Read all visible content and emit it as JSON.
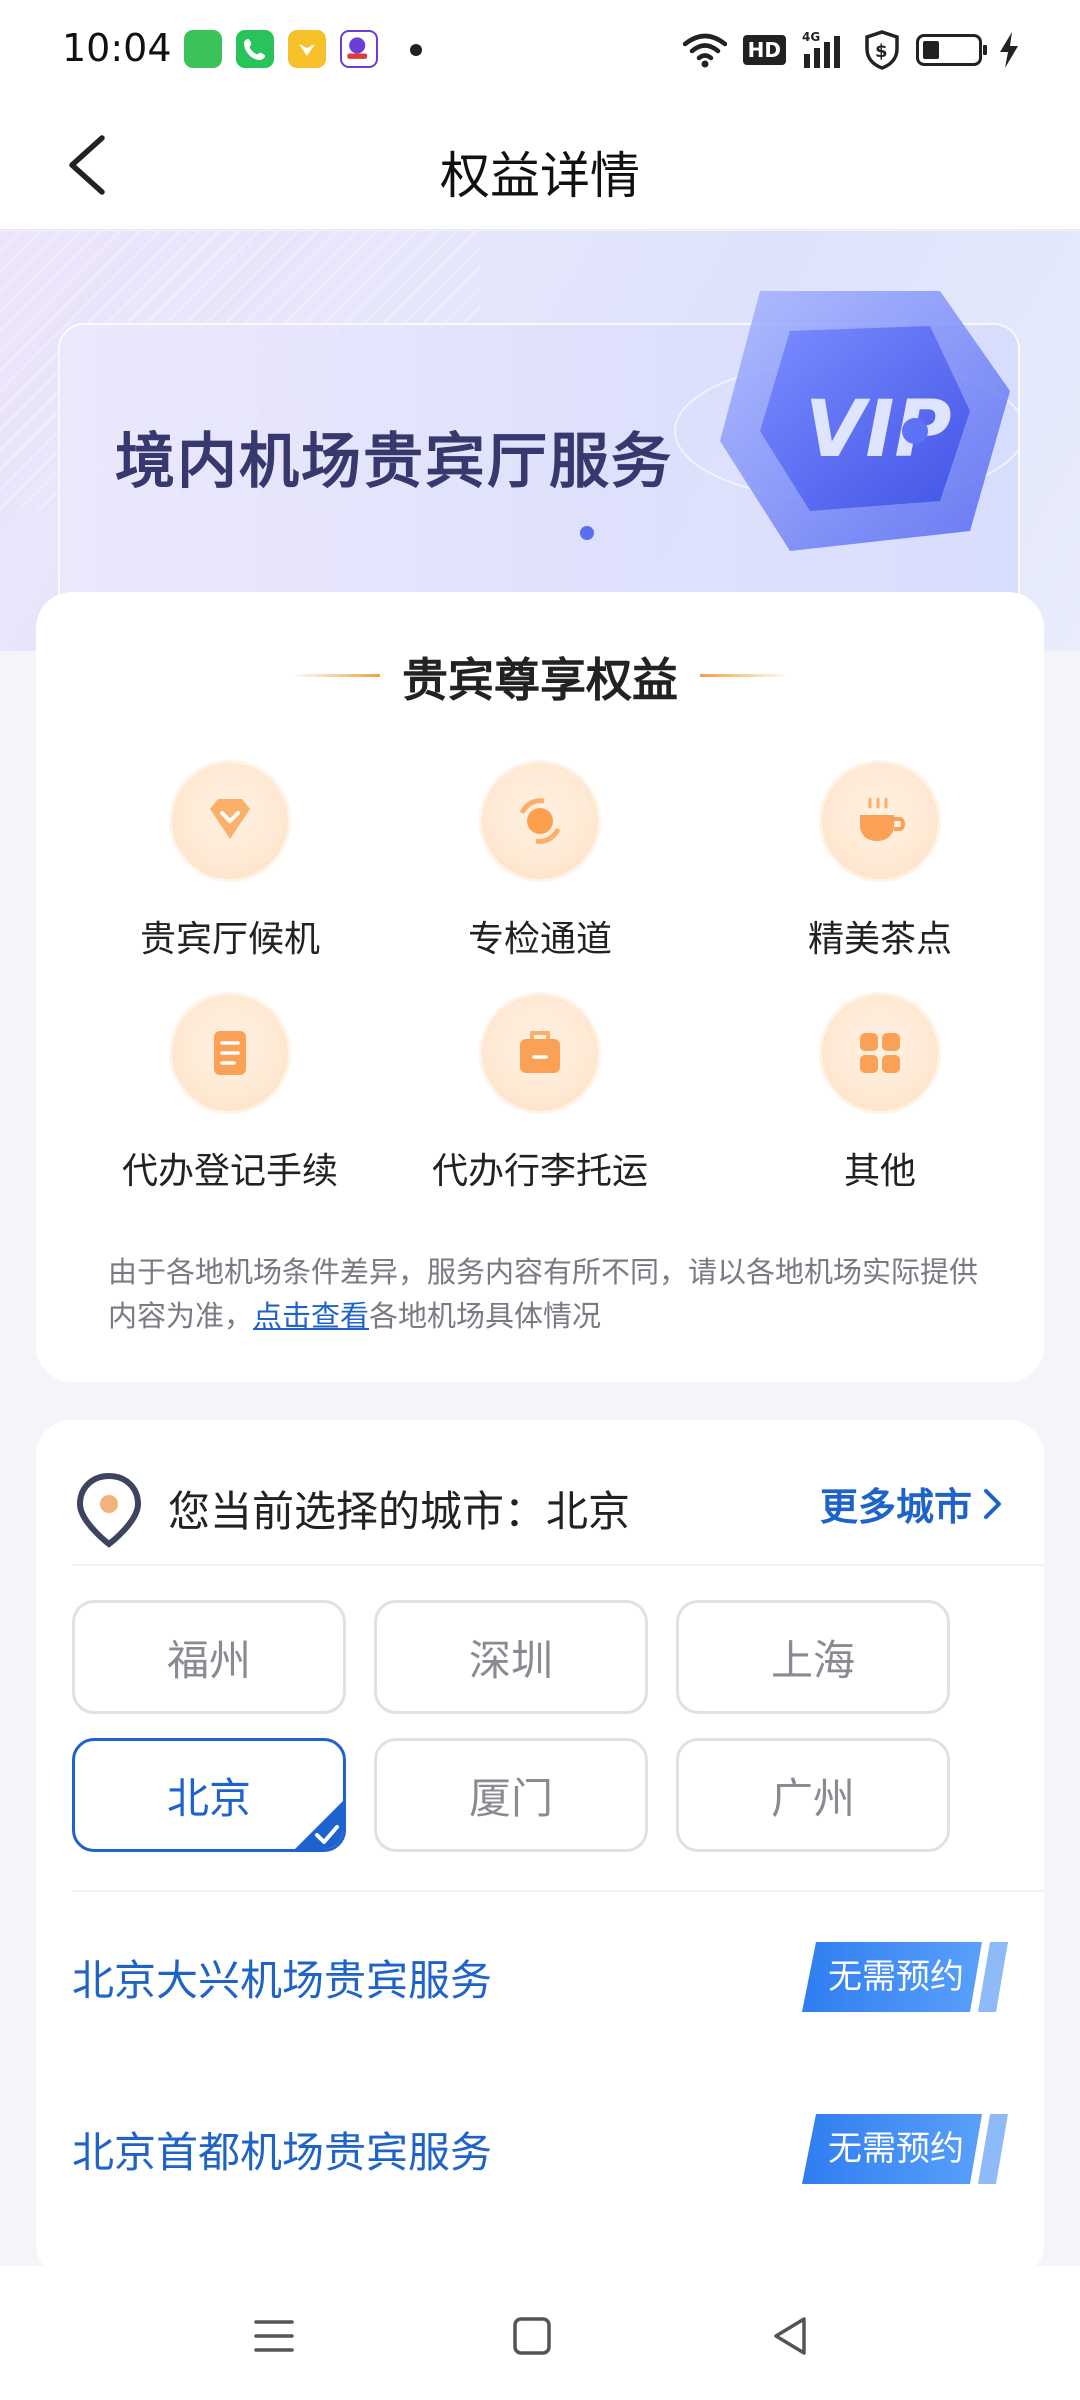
{
  "status_bar": {
    "time": "10:04",
    "network": "HD",
    "network_gen": "4G",
    "icons": [
      "app-green-icon",
      "phone-icon",
      "app-yellow-icon",
      "app-badge-icon",
      "wifi-icon",
      "signal-icon",
      "shield-icon",
      "battery-icon",
      "charging-icon"
    ]
  },
  "nav": {
    "title": "权益详情",
    "back_icon": "back-arrow-icon"
  },
  "hero": {
    "title": "境内机场贵宾厅服务",
    "badge": "VIP"
  },
  "benefits": {
    "title": "贵宾尊享权益",
    "items": [
      {
        "label": "贵宾厅候机",
        "icon": "diamond-icon"
      },
      {
        "label": "专检通道",
        "icon": "security-check-icon"
      },
      {
        "label": "精美茶点",
        "icon": "coffee-cup-icon"
      },
      {
        "label": "代办登记手续",
        "icon": "document-icon"
      },
      {
        "label": "代办行李托运",
        "icon": "luggage-icon"
      },
      {
        "label": "其他",
        "icon": "grid-icon"
      }
    ],
    "notice_before": "由于各地机场条件差异，服务内容有所不同，请以各地机场实际提供内容为准，",
    "notice_link": "点击查看",
    "notice_after": "各地机场具体情况"
  },
  "city": {
    "current_label": "您当前选择的城市：北京",
    "more_label": "更多城市",
    "options": [
      "福州",
      "深圳",
      "上海",
      "北京",
      "厦门",
      "广州"
    ],
    "selected": "北京",
    "services": [
      {
        "name": "北京大兴机场贵宾服务",
        "tag": "无需预约"
      },
      {
        "name": "北京首都机场贵宾服务",
        "tag": "无需预约"
      }
    ]
  },
  "colors": {
    "accent": "#1e63c9",
    "orange": "#f0a046",
    "hero_text": "#36386e"
  }
}
